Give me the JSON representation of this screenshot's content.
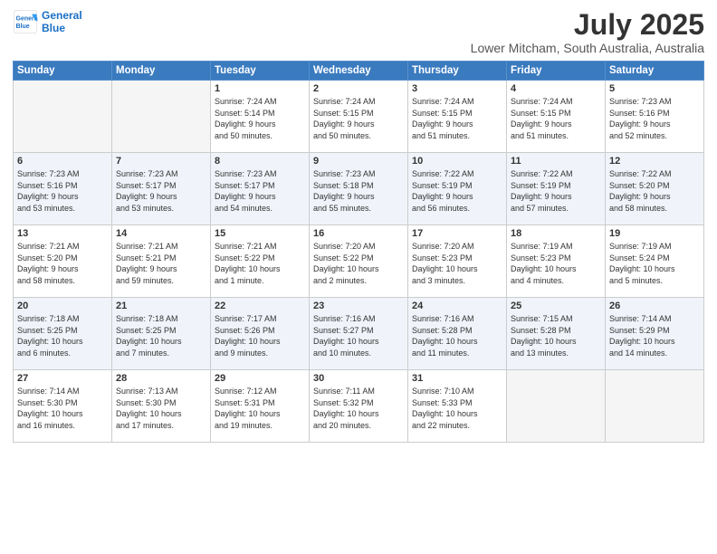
{
  "header": {
    "logo_line1": "General",
    "logo_line2": "Blue",
    "title": "July 2025",
    "subtitle": "Lower Mitcham, South Australia, Australia"
  },
  "days_of_week": [
    "Sunday",
    "Monday",
    "Tuesday",
    "Wednesday",
    "Thursday",
    "Friday",
    "Saturday"
  ],
  "weeks": [
    [
      {
        "day": "",
        "info": ""
      },
      {
        "day": "",
        "info": ""
      },
      {
        "day": "1",
        "info": "Sunrise: 7:24 AM\nSunset: 5:14 PM\nDaylight: 9 hours\nand 50 minutes."
      },
      {
        "day": "2",
        "info": "Sunrise: 7:24 AM\nSunset: 5:15 PM\nDaylight: 9 hours\nand 50 minutes."
      },
      {
        "day": "3",
        "info": "Sunrise: 7:24 AM\nSunset: 5:15 PM\nDaylight: 9 hours\nand 51 minutes."
      },
      {
        "day": "4",
        "info": "Sunrise: 7:24 AM\nSunset: 5:15 PM\nDaylight: 9 hours\nand 51 minutes."
      },
      {
        "day": "5",
        "info": "Sunrise: 7:23 AM\nSunset: 5:16 PM\nDaylight: 9 hours\nand 52 minutes."
      }
    ],
    [
      {
        "day": "6",
        "info": "Sunrise: 7:23 AM\nSunset: 5:16 PM\nDaylight: 9 hours\nand 53 minutes."
      },
      {
        "day": "7",
        "info": "Sunrise: 7:23 AM\nSunset: 5:17 PM\nDaylight: 9 hours\nand 53 minutes."
      },
      {
        "day": "8",
        "info": "Sunrise: 7:23 AM\nSunset: 5:17 PM\nDaylight: 9 hours\nand 54 minutes."
      },
      {
        "day": "9",
        "info": "Sunrise: 7:23 AM\nSunset: 5:18 PM\nDaylight: 9 hours\nand 55 minutes."
      },
      {
        "day": "10",
        "info": "Sunrise: 7:22 AM\nSunset: 5:19 PM\nDaylight: 9 hours\nand 56 minutes."
      },
      {
        "day": "11",
        "info": "Sunrise: 7:22 AM\nSunset: 5:19 PM\nDaylight: 9 hours\nand 57 minutes."
      },
      {
        "day": "12",
        "info": "Sunrise: 7:22 AM\nSunset: 5:20 PM\nDaylight: 9 hours\nand 58 minutes."
      }
    ],
    [
      {
        "day": "13",
        "info": "Sunrise: 7:21 AM\nSunset: 5:20 PM\nDaylight: 9 hours\nand 58 minutes."
      },
      {
        "day": "14",
        "info": "Sunrise: 7:21 AM\nSunset: 5:21 PM\nDaylight: 9 hours\nand 59 minutes."
      },
      {
        "day": "15",
        "info": "Sunrise: 7:21 AM\nSunset: 5:22 PM\nDaylight: 10 hours\nand 1 minute."
      },
      {
        "day": "16",
        "info": "Sunrise: 7:20 AM\nSunset: 5:22 PM\nDaylight: 10 hours\nand 2 minutes."
      },
      {
        "day": "17",
        "info": "Sunrise: 7:20 AM\nSunset: 5:23 PM\nDaylight: 10 hours\nand 3 minutes."
      },
      {
        "day": "18",
        "info": "Sunrise: 7:19 AM\nSunset: 5:23 PM\nDaylight: 10 hours\nand 4 minutes."
      },
      {
        "day": "19",
        "info": "Sunrise: 7:19 AM\nSunset: 5:24 PM\nDaylight: 10 hours\nand 5 minutes."
      }
    ],
    [
      {
        "day": "20",
        "info": "Sunrise: 7:18 AM\nSunset: 5:25 PM\nDaylight: 10 hours\nand 6 minutes."
      },
      {
        "day": "21",
        "info": "Sunrise: 7:18 AM\nSunset: 5:25 PM\nDaylight: 10 hours\nand 7 minutes."
      },
      {
        "day": "22",
        "info": "Sunrise: 7:17 AM\nSunset: 5:26 PM\nDaylight: 10 hours\nand 9 minutes."
      },
      {
        "day": "23",
        "info": "Sunrise: 7:16 AM\nSunset: 5:27 PM\nDaylight: 10 hours\nand 10 minutes."
      },
      {
        "day": "24",
        "info": "Sunrise: 7:16 AM\nSunset: 5:28 PM\nDaylight: 10 hours\nand 11 minutes."
      },
      {
        "day": "25",
        "info": "Sunrise: 7:15 AM\nSunset: 5:28 PM\nDaylight: 10 hours\nand 13 minutes."
      },
      {
        "day": "26",
        "info": "Sunrise: 7:14 AM\nSunset: 5:29 PM\nDaylight: 10 hours\nand 14 minutes."
      }
    ],
    [
      {
        "day": "27",
        "info": "Sunrise: 7:14 AM\nSunset: 5:30 PM\nDaylight: 10 hours\nand 16 minutes."
      },
      {
        "day": "28",
        "info": "Sunrise: 7:13 AM\nSunset: 5:30 PM\nDaylight: 10 hours\nand 17 minutes."
      },
      {
        "day": "29",
        "info": "Sunrise: 7:12 AM\nSunset: 5:31 PM\nDaylight: 10 hours\nand 19 minutes."
      },
      {
        "day": "30",
        "info": "Sunrise: 7:11 AM\nSunset: 5:32 PM\nDaylight: 10 hours\nand 20 minutes."
      },
      {
        "day": "31",
        "info": "Sunrise: 7:10 AM\nSunset: 5:33 PM\nDaylight: 10 hours\nand 22 minutes."
      },
      {
        "day": "",
        "info": ""
      },
      {
        "day": "",
        "info": ""
      }
    ]
  ]
}
